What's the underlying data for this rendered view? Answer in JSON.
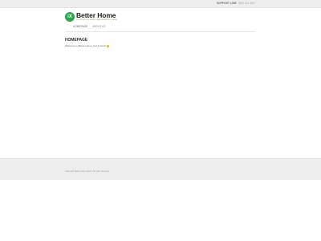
{
  "topbar": {
    "support_label": "SUPPORT LINE",
    "support_text": "0800 123 4567"
  },
  "header": {
    "logo_mark": "iX",
    "logo_text": "Better Home",
    "tagline": "SOLUTIONS FOR HOMES, HEATING AND HOT WATER",
    "nav": [
      {
        "label": "HOMEPAGE"
      },
      {
        "label": "ABOUT US"
      }
    ],
    "brand_color": "#2aa64a"
  },
  "main": {
    "title": "HOMEPAGE",
    "content_text": "Welcome to Better Home. Get in touch"
  },
  "footer": {
    "copyright": "Copyright Better Home 2024. All rights reserved."
  }
}
